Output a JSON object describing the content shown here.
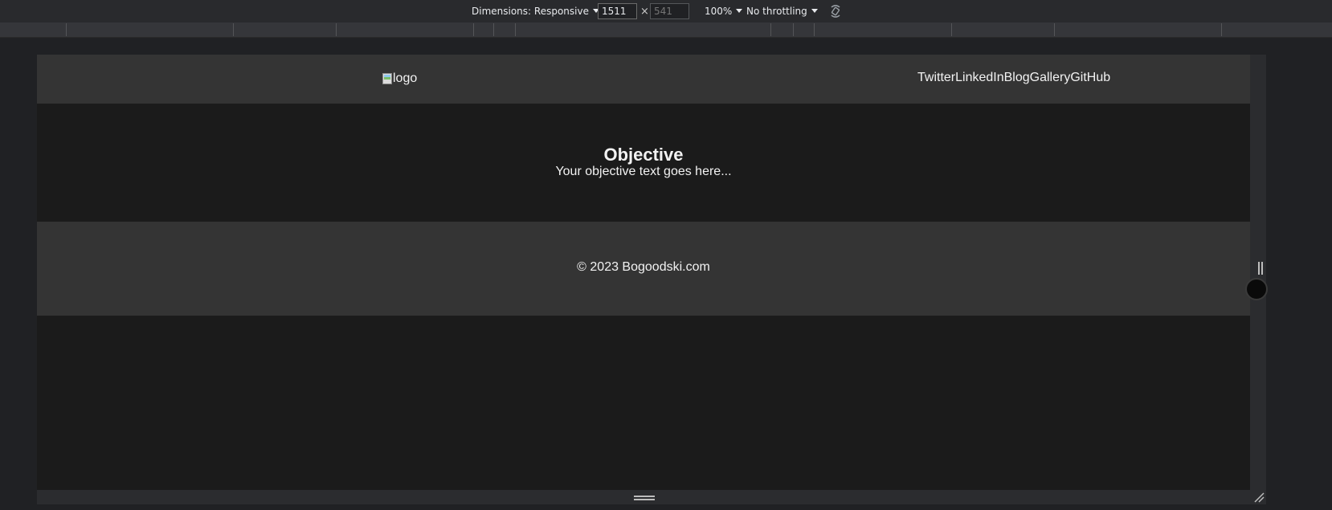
{
  "devtools_toolbar": {
    "dimensions_label": "Dimensions: Responsive",
    "width_value": "1511",
    "height_placeholder": "541",
    "times_symbol": "×",
    "zoom_label": "100%",
    "throttling_label": "No throttling"
  },
  "site": {
    "logo_alt": "logo",
    "nav": [
      "Twitter",
      "LinkedIn",
      "Blog",
      "Gallery",
      "GitHub"
    ],
    "objective_title": "Objective",
    "objective_text": "Your objective text goes here...",
    "footer_text": "© 2023 Bogoodski.com"
  },
  "colors": {
    "devtools_bg": "#202124",
    "header_bg": "#343434",
    "body_bg": "#1b1b1b",
    "text": "#f2f2f2"
  }
}
